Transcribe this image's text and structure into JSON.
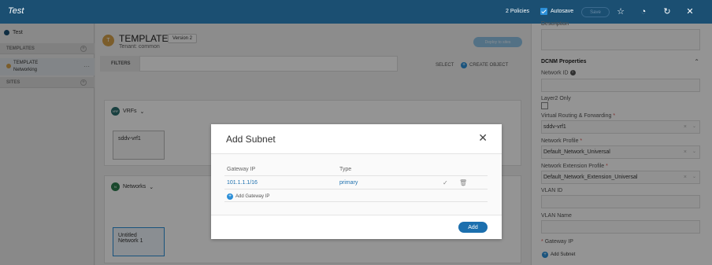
{
  "header": {
    "title": "Test",
    "policies": "2 Policies",
    "autosave_label": "Autosave",
    "save_label": "Save"
  },
  "sidebar": {
    "root_label": "Test",
    "templates_heading": "TEMPLATES",
    "template_item": {
      "line1": "TEMPLATE",
      "line2": "Networking"
    },
    "sites_heading": "SITES"
  },
  "template": {
    "avatar": "T",
    "title": "TEMPLATE",
    "version": "Version 2",
    "tenant": "Tenant: common",
    "deploy_label": "Deploy to sites",
    "filters_label": "FILTERS",
    "select_label": "SELECT",
    "create_object_label": "CREATE OBJECT"
  },
  "vrfs": {
    "heading": "VRFs",
    "badge": "VRF",
    "card": "sddv-vrf1"
  },
  "networks": {
    "heading": "Networks",
    "badge": "N",
    "card_line1": "Untitled",
    "card_line2": "Network 1"
  },
  "right_panel": {
    "description_label": "Description",
    "section_title": "DCNM Properties",
    "network_id_label": "Network ID",
    "layer2_label": "Layer2 Only",
    "vrf_label": "Virtual Routing & Forwarding",
    "vrf_value": "sddv-vrf1",
    "network_profile_label": "Network Profile",
    "network_profile_value": "Default_Network_Universal",
    "ext_profile_label": "Network Extension Profile",
    "ext_profile_value": "Default_Network_Extension_Universal",
    "vlan_id_label": "VLAN ID",
    "vlan_name_label": "VLAN Name",
    "gateway_ip_label": "Gateway IP",
    "add_subnet_label": "Add Subnet"
  },
  "modal": {
    "title": "Add Subnet",
    "col_gateway": "Gateway IP",
    "col_type": "Type",
    "row_gateway": "101.1.1.1/16",
    "row_type": "primary",
    "add_gateway_label": "Add Gateway IP",
    "add_button": "Add"
  },
  "icons": [
    "star-icon",
    "history-icon",
    "refresh-icon",
    "close-icon",
    "check-circle-icon",
    "trash-icon",
    "info-icon",
    "chevron-down-icon",
    "chevron-up-icon",
    "plus-circle-icon"
  ],
  "colors": {
    "header": "#1b4f72",
    "accent": "#1c6fae",
    "checkbox": "#2c8fd8",
    "required": "#d9534f"
  }
}
